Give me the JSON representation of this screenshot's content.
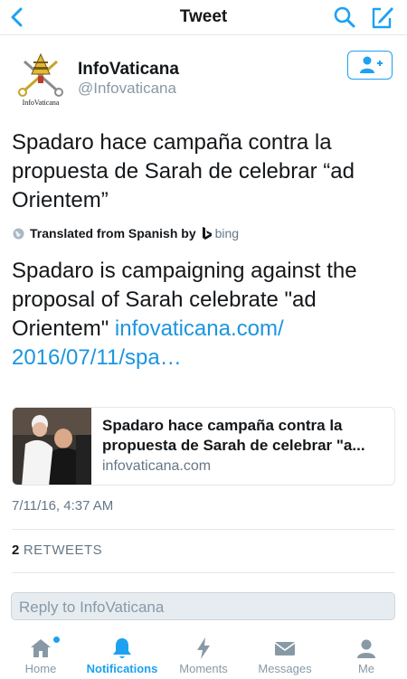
{
  "nav": {
    "title": "Tweet"
  },
  "author": {
    "name": "InfoVaticana",
    "handle": "@Infovaticana",
    "logo_text": "InfoVaticana"
  },
  "tweet": {
    "original_text": "Spadaro hace campaña contra la propuesta de Sarah de celebrar “ad Orientem”",
    "translated_label": "Translated from Spanish by",
    "translator": "bing",
    "translated_text": "Spadaro is campaigning against the proposal of Sarah celebrate \"ad Orientem\"",
    "link_line1": "infovaticana.com/",
    "link_line2": "2016/07/11/spa…",
    "timestamp": "7/11/16, 4:37 AM",
    "retweet_count": "2",
    "retweet_label": "RETWEETS"
  },
  "card": {
    "title": "Spadaro hace campaña contra la propuesta de Sarah de celebrar \"a...",
    "domain": "infovaticana.com"
  },
  "reply": {
    "placeholder": "Reply to InfoVaticana"
  },
  "tabs": [
    {
      "label": "Home",
      "icon": "home-icon",
      "active": false
    },
    {
      "label": "Notifications",
      "icon": "bell-icon",
      "active": true
    },
    {
      "label": "Moments",
      "icon": "lightning-icon",
      "active": false
    },
    {
      "label": "Messages",
      "icon": "envelope-icon",
      "active": false
    },
    {
      "label": "Me",
      "icon": "person-icon",
      "active": false
    }
  ],
  "colors": {
    "accent": "#1da1f2",
    "link": "#1b95e0",
    "muted": "#8899a6"
  }
}
